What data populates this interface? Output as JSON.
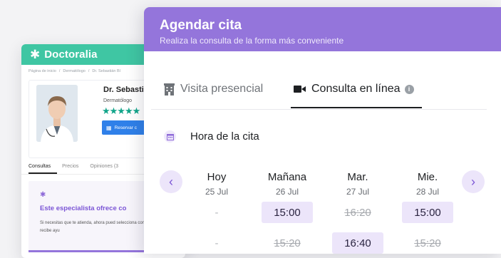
{
  "profile": {
    "brand": "Doctoralia",
    "breadcrumb": [
      "Página de inicio",
      "Dermatólogo",
      "Dr. Sebastián Bl"
    ],
    "doctor_name": "Dr. Sebastiá",
    "specialty": "Dermatólogo",
    "stars": "★★★★★",
    "book_button": "Reservar c",
    "tabs": [
      "Consultas",
      "Precios",
      "Opiniones (3"
    ],
    "promo_title": "Este especialista ofrece co",
    "promo_text": "Si necesitas que te atienda, ahora pued selecciona consulta online y recibe ayu",
    "colors": {
      "brand": "#3fc6a3",
      "accent": "#9475db",
      "button": "#2f80e9"
    }
  },
  "modal": {
    "title": "Agendar cita",
    "subtitle": "Realiza la consulta de la forma más conveniente",
    "tabs": {
      "presencial": "Visita presencial",
      "online": "Consulta en línea",
      "active": "online"
    },
    "time_heading": "Hora de la cita",
    "days": [
      {
        "name": "Hoy",
        "date": "25 Jul",
        "slots": [
          {
            "time": "-",
            "status": "none"
          },
          {
            "time": "-",
            "status": "none"
          }
        ]
      },
      {
        "name": "Mañana",
        "date": "26 Jul",
        "slots": [
          {
            "time": "15:00",
            "status": "available"
          },
          {
            "time": "15:20",
            "status": "taken"
          }
        ]
      },
      {
        "name": "Mar.",
        "date": "27 Jul",
        "slots": [
          {
            "time": "16:20",
            "status": "taken"
          },
          {
            "time": "16:40",
            "status": "available"
          }
        ]
      },
      {
        "name": "Mie.",
        "date": "28 Jul",
        "slots": [
          {
            "time": "15:00",
            "status": "available"
          },
          {
            "time": "15:20",
            "status": "taken"
          }
        ]
      }
    ],
    "icons": {
      "prev": "chevron-left-icon",
      "next": "chevron-right-icon"
    },
    "colors": {
      "header": "#9475db",
      "slot_bg": "#ece5fa"
    }
  }
}
